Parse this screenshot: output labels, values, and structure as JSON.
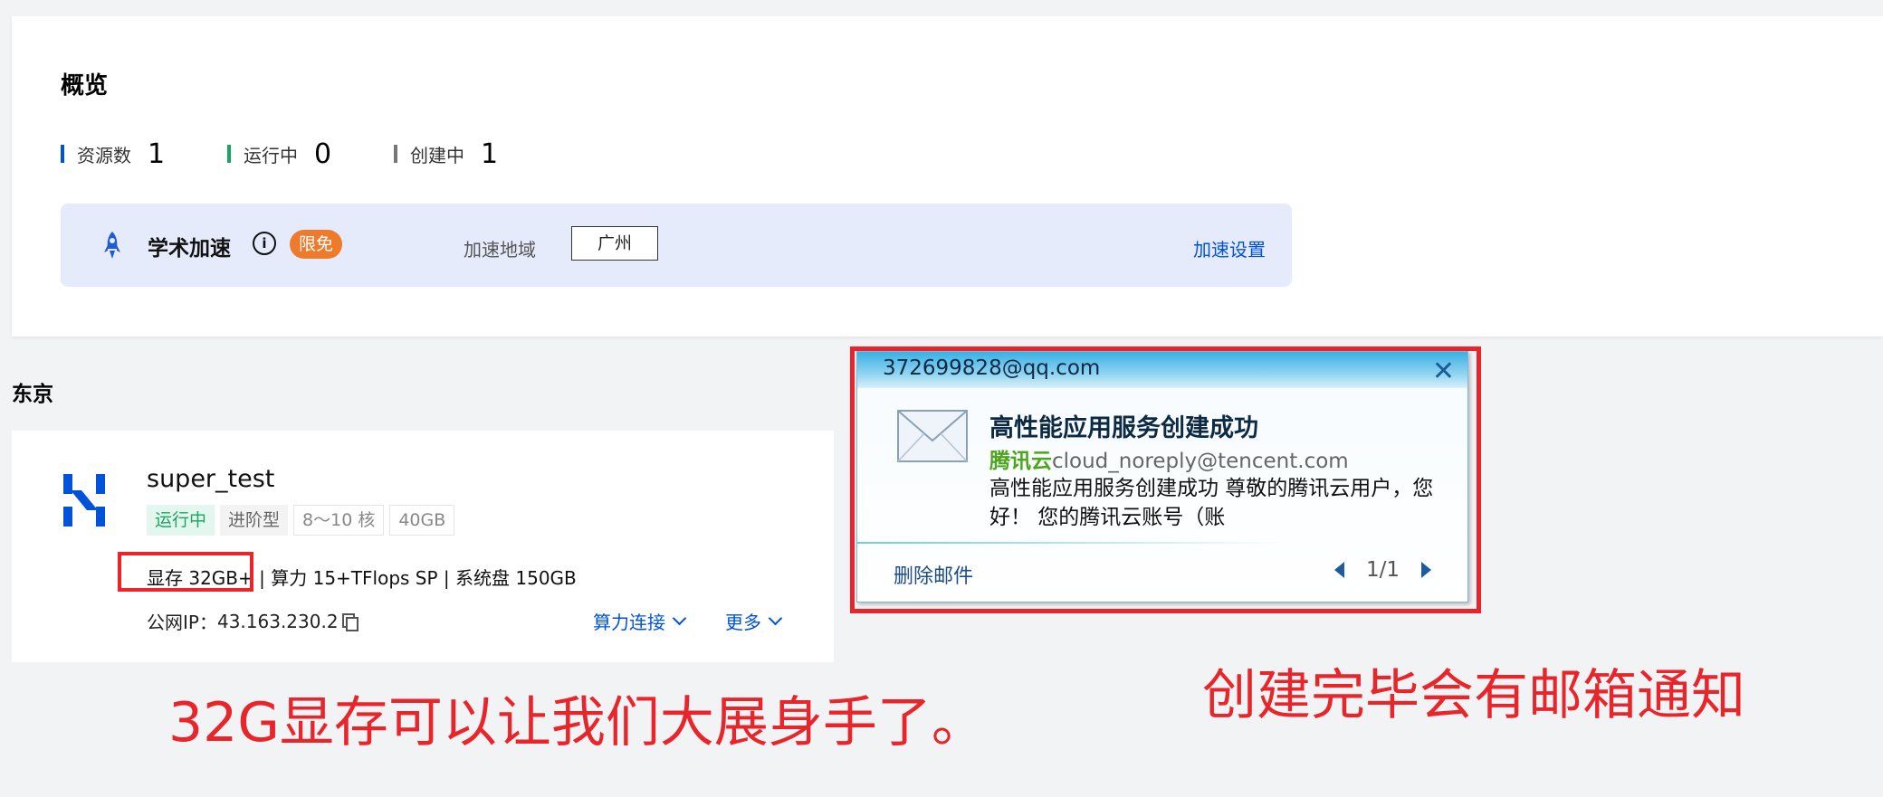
{
  "overview": {
    "title": "概览",
    "stats": [
      {
        "label": "资源数",
        "value": "1",
        "color": "#0052d9"
      },
      {
        "label": "运行中",
        "value": "0",
        "color": "#1aa662"
      },
      {
        "label": "创建中",
        "value": "1",
        "color": "#777777"
      }
    ],
    "accel": {
      "icon": "rocket-icon",
      "title": "学术加速",
      "info_glyph": "i",
      "badge": "限免",
      "region_label": "加速地域",
      "region_value": "广州",
      "settings_link": "加速设置"
    }
  },
  "region": {
    "title": "东京",
    "instance": {
      "name": "super_test",
      "tags": [
        "运行中",
        "进阶型",
        "8～10 核",
        "40GB"
      ],
      "spec_vram": "显存 32GB+",
      "spec_sep": " | ",
      "spec_compute": "算力 15+TFlops SP",
      "spec_disk": "系统盘 150GB",
      "ip_label": "公网IP：",
      "ip_value": "43.163.230.2",
      "connect_link": "算力连接",
      "more_link": "更多"
    }
  },
  "mail": {
    "account": "372699828@qq.com",
    "close_glyph": "✕",
    "subject": "高性能应用服务创建成功",
    "sender_brand": "腾讯云",
    "sender_email": "cloud_noreply@tencent.com",
    "preview": "高性能应用服务创建成功  尊敬的腾讯云用户，您好！  您的腾讯云账号（账",
    "delete_label": "删除邮件",
    "page": "1/1"
  },
  "annotations": {
    "left": "32G显存可以让我们大展身手了。",
    "right": "创建完毕会有邮箱通知",
    "color": "#e8252b"
  }
}
